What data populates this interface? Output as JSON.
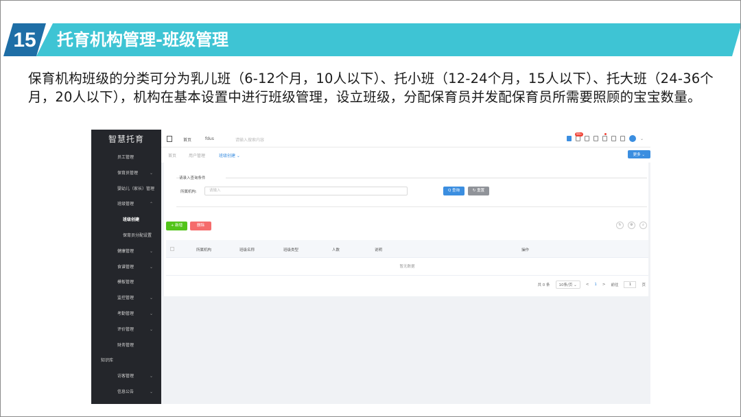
{
  "slide": {
    "number": "15",
    "title": "托育机构管理-班级管理",
    "paragraph": "保育机构班级的分类可分为乳儿班（6-12个月，10人以下）、托小班（12-24个月，15人以下）、托大班（24-36个月，20人以下），机构在基本设置中进行班级管理，设立班级，分配保育员并发配保育员所需要照顾的宝宝数量。"
  },
  "app": {
    "logo": "智慧托育",
    "sidebar": [
      {
        "label": "员工管理",
        "chevron": ""
      },
      {
        "label": "保育员管理",
        "chevron": "⌄"
      },
      {
        "label": "婴幼儿（家长）管理",
        "chevron": ""
      },
      {
        "label": "班级管理",
        "chevron": "⌃"
      },
      {
        "label": "班级创建",
        "chevron": ""
      },
      {
        "label": "保育员分配设置",
        "chevron": ""
      },
      {
        "label": "健康管理",
        "chevron": "⌄"
      },
      {
        "label": "食谱管理",
        "chevron": "⌄"
      },
      {
        "label": "模板管理",
        "chevron": ""
      },
      {
        "label": "监控管理",
        "chevron": "⌄"
      },
      {
        "label": "考勤管理",
        "chevron": "⌄"
      },
      {
        "label": "评价管理",
        "chevron": "⌄"
      },
      {
        "label": "财务管理",
        "chevron": ""
      },
      {
        "label": "知识库",
        "chevron": ""
      },
      {
        "label": "访客管理",
        "chevron": "⌄"
      },
      {
        "label": "信息公告",
        "chevron": "⌄"
      }
    ],
    "topbar": {
      "home": "首页",
      "crumb": "fdus",
      "search_placeholder": "请输入搜索内容",
      "badge": "99+"
    },
    "tabs": [
      "首页",
      "用户管理",
      "班级创建 ⌄"
    ],
    "more_button": "更多 ⌄",
    "query": {
      "title": "请录入查询条件",
      "field_label": "所属机构:",
      "field_placeholder": "请输入",
      "search_button": "Q 查询",
      "reset_button": "↻ 重置"
    },
    "actions": {
      "add": "+ 新增",
      "delete": "删除"
    },
    "table": {
      "columns": [
        "所属机构",
        "班级名称",
        "班级类型",
        "人数",
        "说明",
        "操作"
      ],
      "empty": "暂无数据"
    },
    "pager": {
      "total": "共 0 条",
      "page_size": "10条/页 ⌄",
      "prev": "<",
      "page": "1",
      "next": ">",
      "goto_label": "前往",
      "goto_value": "1",
      "goto_suffix": "页"
    }
  }
}
